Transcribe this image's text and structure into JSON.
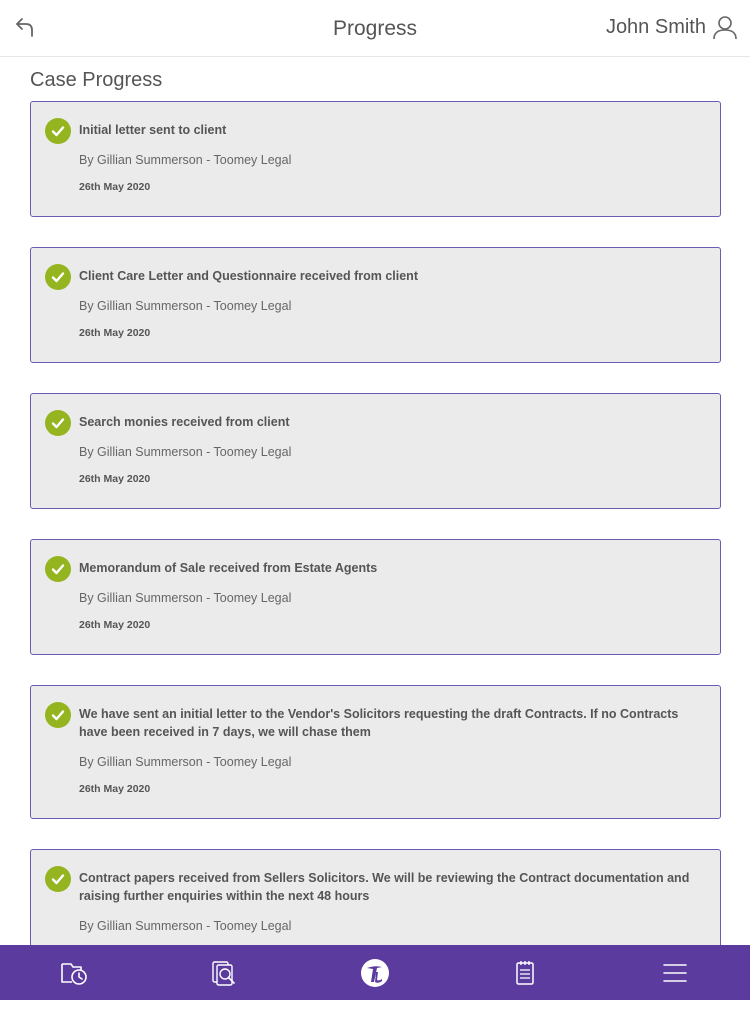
{
  "header": {
    "title": "Progress",
    "user_name": "John Smith"
  },
  "section_title": "Case Progress",
  "items": [
    {
      "title": "Initial letter sent to client",
      "by": "By Gillian Summerson - Toomey Legal",
      "date": "26th May 2020"
    },
    {
      "title": "Client Care Letter and Questionnaire received from client",
      "by": "By Gillian Summerson - Toomey Legal",
      "date": "26th May 2020"
    },
    {
      "title": "Search monies received from client",
      "by": "By Gillian Summerson - Toomey Legal",
      "date": "26th May 2020"
    },
    {
      "title": "Memorandum of Sale received from Estate Agents",
      "by": "By Gillian Summerson - Toomey Legal",
      "date": "26th May 2020"
    },
    {
      "title": "We have sent an initial letter to the Vendor's Solicitors requesting the draft Contracts. If no Contracts have been received in 7 days, we will chase them",
      "by": "By Gillian Summerson - Toomey Legal",
      "date": "26th May 2020"
    },
    {
      "title": "Contract papers received from Sellers Solicitors. We will be reviewing the Contract documentation and raising further enquiries within the next 48 hours",
      "by": "By Gillian Summerson - Toomey Legal",
      "date": ""
    }
  ],
  "tabbar": {
    "tabs": [
      "progress-icon",
      "document-search-icon",
      "logo-icon",
      "notes-icon",
      "menu-icon"
    ],
    "background": "#5b3b9e"
  },
  "colors": {
    "check": "#94b51f",
    "card_border": "#6b5bb5",
    "card_bg": "#ebebeb"
  }
}
